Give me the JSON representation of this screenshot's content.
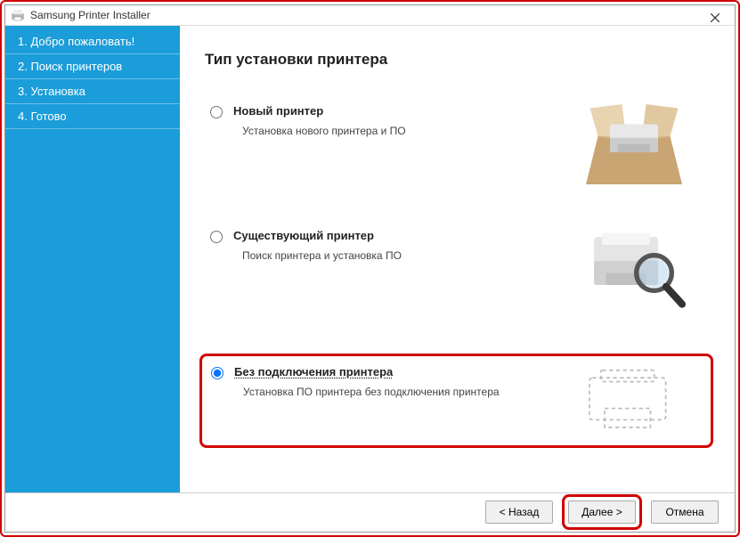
{
  "window": {
    "title": "Samsung Printer Installer"
  },
  "sidebar": {
    "items": [
      {
        "label": "1. Добро пожаловать!"
      },
      {
        "label": "2. Поиск принтеров"
      },
      {
        "label": "3. Установка"
      },
      {
        "label": "4. Готово"
      }
    ]
  },
  "main": {
    "heading": "Тип установки принтера",
    "options": [
      {
        "label": "Новый принтер",
        "desc": "Установка нового принтера и ПО",
        "selected": false
      },
      {
        "label": "Существующий принтер",
        "desc": "Поиск принтера и установка ПО",
        "selected": false
      },
      {
        "label": "Без подключения принтера",
        "desc": "Установка ПО принтера без подключения принтера",
        "selected": true
      }
    ]
  },
  "footer": {
    "back": "< Назад",
    "next": "Далее >",
    "cancel": "Отмена"
  }
}
